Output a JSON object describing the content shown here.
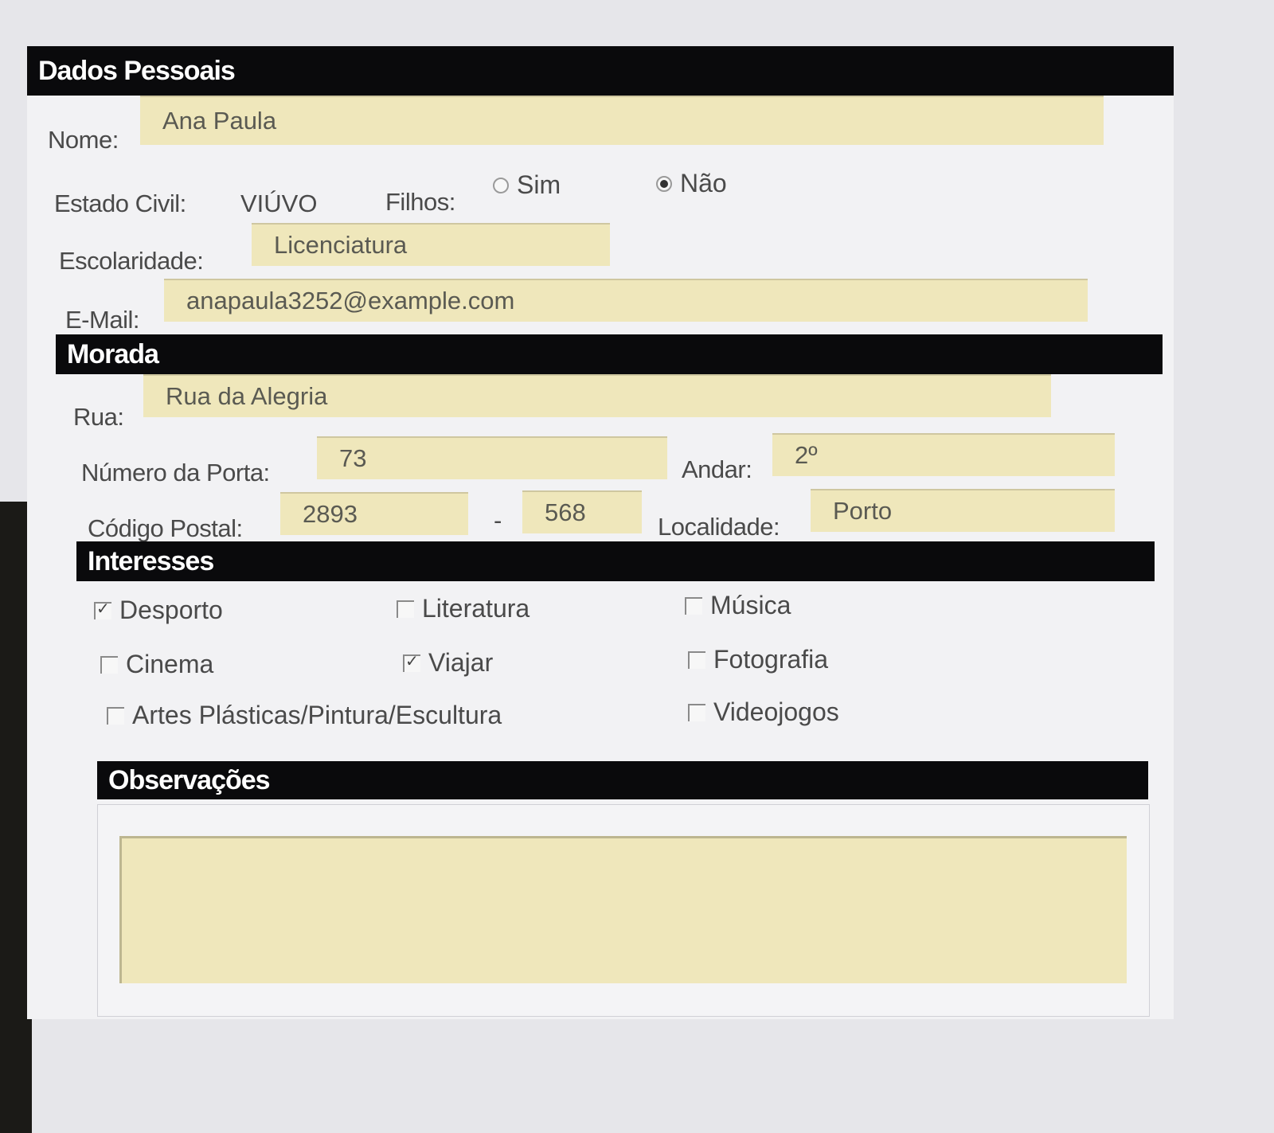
{
  "sections": {
    "personal": "Dados Pessoais",
    "address": "Morada",
    "interests": "Interesses",
    "notes": "Observações"
  },
  "personal": {
    "name_label": "Nome:",
    "name_value": "Ana Paula",
    "civil_label": "Estado Civil:",
    "civil_value": "VIÚVO",
    "children_label": "Filhos:",
    "children_yes": "Sim",
    "children_no": "Não",
    "children_selected": "Não",
    "education_label": "Escolaridade:",
    "education_value": "Licenciatura",
    "email_label": "E-Mail:",
    "email_value": "anapaula3252@example.com"
  },
  "address": {
    "street_label": "Rua:",
    "street_value": "Rua da Alegria",
    "door_label": "Número da Porta:",
    "door_value": "73",
    "floor_label": "Andar:",
    "floor_value": "2º",
    "postal_label": "Código Postal:",
    "postal_part1": "2893",
    "postal_sep": "-",
    "postal_part2": "568",
    "locality_label": "Localidade:",
    "locality_value": "Porto"
  },
  "interests": [
    {
      "label": "Desporto",
      "checked": true
    },
    {
      "label": "Literatura",
      "checked": false
    },
    {
      "label": "Música",
      "checked": false
    },
    {
      "label": "Cinema",
      "checked": false
    },
    {
      "label": "Viajar",
      "checked": true
    },
    {
      "label": "Fotografia",
      "checked": false
    },
    {
      "label": "Artes Plásticas/Pintura/Escultura",
      "checked": false
    },
    {
      "label": "Videojogos",
      "checked": false
    }
  ],
  "notes": {
    "value": ""
  },
  "colors": {
    "band": "#0a0a0c",
    "field": "#efe7bb",
    "panel": "#f2f2f4"
  }
}
